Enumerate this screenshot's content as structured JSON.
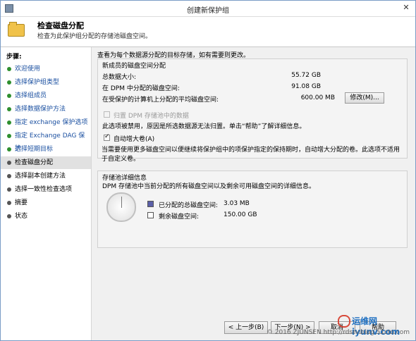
{
  "window": {
    "title": "创建新保护组",
    "close_glyph": "✕"
  },
  "header": {
    "title": "检查磁盘分配",
    "subtitle": "检查为此保护组分配的存储池磁盘空间。"
  },
  "nav": {
    "title": "步骤:",
    "items": [
      {
        "label": "欢迎使用",
        "state": "done"
      },
      {
        "label": "选择保护组类型",
        "state": "done"
      },
      {
        "label": "选择组成员",
        "state": "done"
      },
      {
        "label": "选择数据保护方法",
        "state": "done"
      },
      {
        "label": "指定 exchange 保护选项",
        "state": "done"
      },
      {
        "label": "指定 Exchange DAG 保护",
        "state": "done"
      },
      {
        "label": "选择短期目标",
        "state": "done"
      },
      {
        "label": "检查磁盘分配",
        "state": "current"
      },
      {
        "label": "选择副本创建方法",
        "state": "pending"
      },
      {
        "label": "选择一致性检查选项",
        "state": "pending"
      },
      {
        "label": "摘要",
        "state": "pending"
      },
      {
        "label": "状态",
        "state": "pending"
      }
    ]
  },
  "content": {
    "intro": "查看为每个数据源分配的目标存储，如有需要则更改。",
    "allocation_group": {
      "title": "新成员的磁盘空间分配",
      "total_data_label": "总数据大小:",
      "total_data_value": "55.72 GB",
      "dpm_allocated_label": "在 DPM 中分配的磁盘空间:",
      "dpm_allocated_value": "91.08 GB",
      "avg_protected_label": "在受保护的计算机上分配的平均磁盘空间:",
      "avg_protected_value": "600.00 MB",
      "modify_button": "修改(M)...",
      "colocate_label": "归置 DPM 存储池中的数据",
      "colocate_checked": false,
      "colocate_note": "此选项被禁用，原因是所选数据源无法归置。单击“帮助”了解详细信息。",
      "autogrow_label": "自动增大卷(A)",
      "autogrow_checked": true,
      "autogrow_note_1": "当需要使用更多磁盘空间以便继续将保护组中的项保护指定的保持期时，自动增大分配的卷。此选项不适用",
      "autogrow_note_2": "于自定义卷。"
    },
    "pool_group": {
      "title": "存储池详细信息",
      "description": "DPM 存储池中当前分配的所有磁盘空间以及剩余可用磁盘空间的详细信息。",
      "allocated_label": "已分配的总磁盘空间:",
      "allocated_value": "3.03 MB",
      "allocated_color": "#5b5fa8",
      "remaining_label": "剩余磁盘空间:",
      "remaining_value": "150.00 GB",
      "remaining_color": "#ffffff"
    }
  },
  "footer": {
    "back": "< 上一步(B)",
    "next": "下一步(N) >",
    "cancel": "取消",
    "help": "帮助"
  },
  "watermark": "© 2016 ZJUNSEN http://rdsrv.blog.51cto.com",
  "logo_text": "运维网 iyunv.com"
}
